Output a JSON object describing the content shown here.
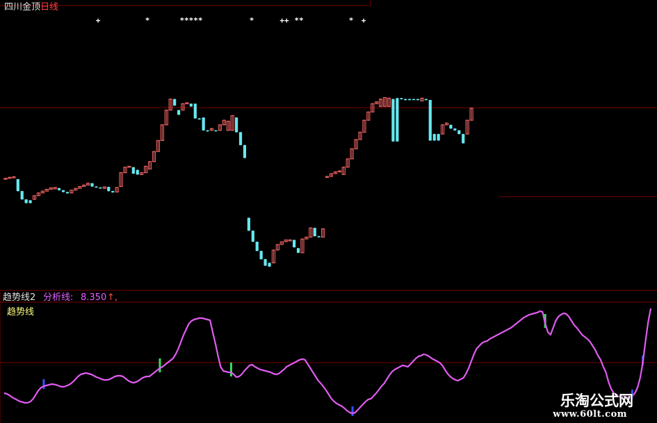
{
  "colors": {
    "background": "#000000",
    "up_candle": "#ff6a6a",
    "down_candle": "#66e8f0",
    "grid": "#7a0000",
    "trend_line": "#e05cf0",
    "green_marker": "#30e060",
    "blue_marker": "#3050ff",
    "signal_star": "#ffffff"
  },
  "main_panel": {
    "name": "四川金顶",
    "period": "日线",
    "signal_labels": [
      "+",
      "*",
      "*****",
      "*",
      "++",
      "**",
      "*",
      "+"
    ]
  },
  "indicator_panel": {
    "name": "趋势线2",
    "series_label": "分析线:",
    "value": "8.350",
    "arrow": "↑,",
    "legend": "趋势线"
  },
  "watermark": {
    "title": "乐淘公式网",
    "url": "www.60lt.com"
  },
  "chart_data": [
    {
      "type": "candlestick",
      "title": "四川金顶 日线",
      "note": "relative price index, no axis values printed",
      "ylim": [
        0,
        100
      ],
      "candles": [
        {
          "o": 55.5,
          "c": 56.0,
          "h": 56.2,
          "l": 55.3
        },
        {
          "o": 56.2,
          "c": 56.5,
          "h": 56.8,
          "l": 56.0
        },
        {
          "o": 56.4,
          "c": 56.8,
          "h": 57.0,
          "l": 56.2
        },
        {
          "o": 55.5,
          "c": 49.0,
          "h": 55.6,
          "l": 48.8
        },
        {
          "o": 49.0,
          "c": 44.5,
          "h": 49.2,
          "l": 44.3
        },
        {
          "o": 44.5,
          "c": 42.5,
          "h": 44.6,
          "l": 42.3
        },
        {
          "o": 44.0,
          "c": 42.5,
          "h": 44.2,
          "l": 42.3
        },
        {
          "o": 44.5,
          "c": 46.5,
          "h": 46.8,
          "l": 44.3
        },
        {
          "o": 46.5,
          "c": 48.0,
          "h": 48.2,
          "l": 46.4
        },
        {
          "o": 48.0,
          "c": 49.0,
          "h": 49.3,
          "l": 47.9
        },
        {
          "o": 49.0,
          "c": 50.0,
          "h": 50.2,
          "l": 48.8
        },
        {
          "o": 50.0,
          "c": 50.8,
          "h": 51.0,
          "l": 49.8
        },
        {
          "o": 50.2,
          "c": 51.0,
          "h": 51.2,
          "l": 50.0
        },
        {
          "o": 50.6,
          "c": 49.5,
          "h": 50.8,
          "l": 49.3
        },
        {
          "o": 49.5,
          "c": 48.5,
          "h": 49.6,
          "l": 48.3
        },
        {
          "o": 48.5,
          "c": 47.8,
          "h": 48.7,
          "l": 47.6
        },
        {
          "o": 48.0,
          "c": 49.5,
          "h": 49.7,
          "l": 47.8
        },
        {
          "o": 49.5,
          "c": 50.5,
          "h": 50.7,
          "l": 49.3
        },
        {
          "o": 50.5,
          "c": 51.5,
          "h": 51.7,
          "l": 50.3
        },
        {
          "o": 51.5,
          "c": 52.3,
          "h": 52.5,
          "l": 51.3
        },
        {
          "o": 52.3,
          "c": 53.3,
          "h": 53.5,
          "l": 52.1
        },
        {
          "o": 53.3,
          "c": 51.5,
          "h": 53.4,
          "l": 51.3
        },
        {
          "o": 51.5,
          "c": 51.0,
          "h": 51.6,
          "l": 50.8
        },
        {
          "o": 51.0,
          "c": 50.5,
          "h": 51.1,
          "l": 50.3
        },
        {
          "o": 50.5,
          "c": 51.3,
          "h": 51.5,
          "l": 50.3
        },
        {
          "o": 51.3,
          "c": 49.0,
          "h": 51.4,
          "l": 48.8
        },
        {
          "o": 49.0,
          "c": 48.3,
          "h": 49.2,
          "l": 48.1
        },
        {
          "o": 48.5,
          "c": 51.0,
          "h": 51.2,
          "l": 48.3
        },
        {
          "o": 51.5,
          "c": 59.0,
          "h": 59.3,
          "l": 51.3
        },
        {
          "o": 59.0,
          "c": 62.0,
          "h": 62.3,
          "l": 58.8
        },
        {
          "o": 62.0,
          "c": 62.5,
          "h": 62.7,
          "l": 61.8
        },
        {
          "o": 62.0,
          "c": 58.5,
          "h": 62.2,
          "l": 58.3
        },
        {
          "o": 60.5,
          "c": 58.0,
          "h": 60.7,
          "l": 57.8
        },
        {
          "o": 58.0,
          "c": 59.0,
          "h": 59.3,
          "l": 57.8
        },
        {
          "o": 59.0,
          "c": 62.5,
          "h": 62.8,
          "l": 58.8
        },
        {
          "o": 61.0,
          "c": 65.0,
          "h": 65.3,
          "l": 60.8
        },
        {
          "o": 65.0,
          "c": 70.5,
          "h": 70.8,
          "l": 64.8
        },
        {
          "o": 70.5,
          "c": 76.5,
          "h": 76.8,
          "l": 70.3
        },
        {
          "o": 76.5,
          "c": 85.0,
          "h": 85.3,
          "l": 76.3
        },
        {
          "o": 85.0,
          "c": 93.0,
          "h": 93.3,
          "l": 84.8
        },
        {
          "o": 93.0,
          "c": 99.0,
          "h": 99.3,
          "l": 92.8
        },
        {
          "o": 99.0,
          "c": 95.5,
          "h": 99.2,
          "l": 95.3
        },
        {
          "o": 93.0,
          "c": 90.5,
          "h": 93.2,
          "l": 90.3
        },
        {
          "o": 93.0,
          "c": 96.5,
          "h": 96.8,
          "l": 92.8
        },
        {
          "o": 96.5,
          "c": 97.0,
          "h": 97.2,
          "l": 96.3
        },
        {
          "o": 96.5,
          "c": 95.0,
          "h": 96.6,
          "l": 94.8
        },
        {
          "o": 96.5,
          "c": 88.5,
          "h": 96.6,
          "l": 88.3
        },
        {
          "o": 88.5,
          "c": 88.0,
          "h": 88.7,
          "l": 87.8
        },
        {
          "o": 89.0,
          "c": 82.0,
          "h": 89.1,
          "l": 81.8
        },
        {
          "o": 82.0,
          "c": 81.5,
          "h": 82.2,
          "l": 81.3
        },
        {
          "o": 82.0,
          "c": 83.0,
          "h": 83.3,
          "l": 81.8
        },
        {
          "o": 82.0,
          "c": 81.8,
          "h": 82.2,
          "l": 81.6
        },
        {
          "o": 82.0,
          "c": 85.0,
          "h": 85.3,
          "l": 81.8
        },
        {
          "o": 85.0,
          "c": 87.5,
          "h": 87.8,
          "l": 84.8
        },
        {
          "o": 82.0,
          "c": 87.0,
          "h": 87.3,
          "l": 81.8
        },
        {
          "o": 82.0,
          "c": 90.0,
          "h": 90.3,
          "l": 81.8
        },
        {
          "o": 89.0,
          "c": 81.0,
          "h": 89.1,
          "l": 80.8
        },
        {
          "o": 81.0,
          "c": 74.0,
          "h": 81.2,
          "l": 73.8
        },
        {
          "o": 74.0,
          "c": 67.0,
          "h": 74.2,
          "l": 66.8
        },
        {
          "o": 34.5,
          "c": 27.5,
          "h": 34.6,
          "l": 27.3
        },
        {
          "o": 27.5,
          "c": 21.5,
          "h": 27.6,
          "l": 21.3
        },
        {
          "o": 21.5,
          "c": 16.5,
          "h": 21.6,
          "l": 16.3
        },
        {
          "o": 16.5,
          "c": 12.0,
          "h": 16.6,
          "l": 11.8
        },
        {
          "o": 12.0,
          "c": 8.5,
          "h": 12.2,
          "l": 8.3
        },
        {
          "o": 10.0,
          "c": 8.0,
          "h": 10.2,
          "l": 7.8
        },
        {
          "o": 10.0,
          "c": 17.0,
          "h": 17.2,
          "l": 9.8
        },
        {
          "o": 17.0,
          "c": 20.0,
          "h": 20.2,
          "l": 16.8
        },
        {
          "o": 20.0,
          "c": 21.5,
          "h": 21.7,
          "l": 19.8
        },
        {
          "o": 21.5,
          "c": 22.5,
          "h": 22.7,
          "l": 21.3
        },
        {
          "o": 22.5,
          "c": 22.5,
          "h": 22.8,
          "l": 22.2
        },
        {
          "o": 22.5,
          "c": 18.5,
          "h": 22.6,
          "l": 18.3
        },
        {
          "o": 18.0,
          "c": 15.5,
          "h": 18.2,
          "l": 15.3
        },
        {
          "o": 15.5,
          "c": 23.0,
          "h": 23.3,
          "l": 15.3
        },
        {
          "o": 23.0,
          "c": 24.0,
          "h": 24.3,
          "l": 22.8
        },
        {
          "o": 24.0,
          "c": 29.0,
          "h": 29.3,
          "l": 23.8
        },
        {
          "o": 29.0,
          "c": 24.5,
          "h": 29.2,
          "l": 24.3
        },
        {
          "o": 24.5,
          "c": 24.0,
          "h": 24.7,
          "l": 23.8
        },
        {
          "o": 24.0,
          "c": 28.5,
          "h": 28.8,
          "l": 23.8
        },
        {
          "o": 56.5,
          "c": 57.0,
          "h": 57.2,
          "l": 56.3
        },
        {
          "o": 57.0,
          "c": 58.5,
          "h": 58.8,
          "l": 56.8
        },
        {
          "o": 58.5,
          "c": 59.5,
          "h": 59.8,
          "l": 58.3
        },
        {
          "o": 59.5,
          "c": 60.0,
          "h": 60.3,
          "l": 59.3
        },
        {
          "o": 58.0,
          "c": 62.0,
          "h": 62.3,
          "l": 57.8
        },
        {
          "o": 62.0,
          "c": 66.5,
          "h": 66.8,
          "l": 61.8
        },
        {
          "o": 66.5,
          "c": 72.0,
          "h": 72.3,
          "l": 66.3
        },
        {
          "o": 72.0,
          "c": 77.0,
          "h": 77.3,
          "l": 71.8
        },
        {
          "o": 77.0,
          "c": 81.0,
          "h": 81.3,
          "l": 76.8
        },
        {
          "o": 81.0,
          "c": 87.5,
          "h": 87.8,
          "l": 80.8
        },
        {
          "o": 87.5,
          "c": 92.0,
          "h": 92.3,
          "l": 87.3
        },
        {
          "o": 92.0,
          "c": 96.5,
          "h": 96.8,
          "l": 91.8
        },
        {
          "o": 96.5,
          "c": 97.5,
          "h": 97.8,
          "l": 96.3
        },
        {
          "o": 95.0,
          "c": 99.0,
          "h": 99.3,
          "l": 94.8
        },
        {
          "o": 95.0,
          "c": 99.8,
          "h": 100,
          "l": 94.8
        },
        {
          "o": 95.0,
          "c": 99.5,
          "h": 99.8,
          "l": 94.8
        },
        {
          "o": 99.0,
          "c": 76.0,
          "h": 99.2,
          "l": 75.8
        },
        {
          "o": 99.5,
          "c": 76.0,
          "h": 99.7,
          "l": 75.8
        },
        {
          "o": 99.5,
          "c": 99.0,
          "h": 99.7,
          "l": 98.8
        },
        {
          "o": 99.0,
          "c": 98.5,
          "h": 99.2,
          "l": 98.3
        },
        {
          "o": 99.0,
          "c": 98.5,
          "h": 99.2,
          "l": 98.3
        },
        {
          "o": 99.0,
          "c": 98.8,
          "h": 99.2,
          "l": 98.6
        },
        {
          "o": 99.0,
          "c": 98.5,
          "h": 99.2,
          "l": 98.3
        },
        {
          "o": 98.0,
          "c": 99.5,
          "h": 99.8,
          "l": 97.8
        },
        {
          "o": 99.0,
          "c": 98.5,
          "h": 99.2,
          "l": 98.3
        },
        {
          "o": 98.5,
          "c": 76.5,
          "h": 98.6,
          "l": 76.3
        },
        {
          "o": 80.0,
          "c": 76.5,
          "h": 80.2,
          "l": 76.3
        },
        {
          "o": 80.0,
          "c": 76.5,
          "h": 80.2,
          "l": 76.3
        },
        {
          "o": 80.0,
          "c": 85.0,
          "h": 85.3,
          "l": 79.8
        },
        {
          "o": 85.0,
          "c": 86.0,
          "h": 86.3,
          "l": 84.8
        },
        {
          "o": 85.0,
          "c": 83.0,
          "h": 85.2,
          "l": 82.8
        },
        {
          "o": 83.0,
          "c": 82.0,
          "h": 83.2,
          "l": 81.8
        },
        {
          "o": 82.0,
          "c": 80.0,
          "h": 82.2,
          "l": 79.8
        },
        {
          "o": 80.0,
          "c": 75.0,
          "h": 80.2,
          "l": 74.8
        },
        {
          "o": 80.0,
          "c": 87.5,
          "h": 87.8,
          "l": 79.8
        },
        {
          "o": 87.5,
          "c": 94.0,
          "h": 94.3,
          "l": 87.3
        }
      ]
    },
    {
      "type": "line",
      "title": "趋势线2",
      "series": [
        {
          "name": "分析线",
          "last_value": 8.35,
          "values": [
            16,
            15.5,
            14.5,
            13,
            12,
            11,
            10,
            9.5,
            9,
            9.2,
            10,
            12,
            15,
            18,
            20,
            21,
            21.5,
            22,
            22.5,
            22.3,
            21.8,
            21,
            20.5,
            20.8,
            21.5,
            22.5,
            24,
            26,
            28,
            29.5,
            30,
            30.5,
            30,
            29.5,
            28.5,
            27.5,
            26.8,
            26,
            25.5,
            25.5,
            26,
            27,
            28,
            28.5,
            28.5,
            28,
            26.5,
            25,
            24,
            23.5,
            24,
            25,
            26.5,
            27.5,
            28,
            28,
            29.5,
            31,
            32.5,
            34,
            35,
            36.5,
            38,
            39.5,
            41,
            44,
            48,
            53,
            58,
            62,
            66,
            68,
            69,
            69.5,
            70,
            70,
            69.5,
            69,
            68.5,
            60,
            52,
            43,
            35,
            32,
            31.5,
            31,
            31,
            29.5,
            27.5,
            28,
            29.5,
            32,
            34,
            36,
            36.5,
            35,
            34,
            33,
            32.5,
            32,
            31.5,
            31,
            30,
            29.5,
            30,
            31.5,
            33,
            35,
            36,
            37,
            38,
            39,
            40,
            40.5,
            40,
            37,
            34,
            31,
            28,
            25,
            23,
            20.5,
            18,
            15,
            12,
            10,
            8.5,
            7.5,
            6.5,
            5,
            3.2,
            2,
            1.5,
            2,
            4,
            6,
            8,
            10,
            11.5,
            12,
            14,
            16,
            18.5,
            21,
            23,
            26,
            29,
            31.5,
            33,
            34,
            35,
            36,
            35.5,
            35,
            37,
            39,
            41,
            42.5,
            43,
            44,
            43.5,
            42.5,
            41,
            40,
            39,
            38,
            36,
            33,
            30,
            28,
            26.5,
            25.5,
            25,
            26,
            27,
            30,
            34,
            39,
            44,
            48,
            50,
            52,
            53,
            53.5,
            55,
            56,
            57,
            58,
            59,
            60,
            61,
            62,
            63,
            64.5,
            66,
            67.5,
            69,
            70.5,
            71.5,
            72.5,
            73,
            73.5,
            74,
            75,
            74.5,
            66,
            60,
            58,
            63,
            68,
            71,
            72.5,
            73.5,
            73,
            71,
            68,
            65,
            63,
            60.5,
            58,
            56.5,
            55,
            53,
            50,
            47,
            43,
            40,
            35,
            31,
            24,
            19,
            16,
            14,
            13.5,
            14,
            13.5,
            13,
            13,
            13.5,
            16,
            20,
            27,
            38,
            53,
            67,
            77
          ]
        }
      ],
      "green_markers_at": [
        59,
        86,
        205
      ],
      "blue_markers_at": [
        15,
        132,
        238,
        242
      ]
    }
  ]
}
